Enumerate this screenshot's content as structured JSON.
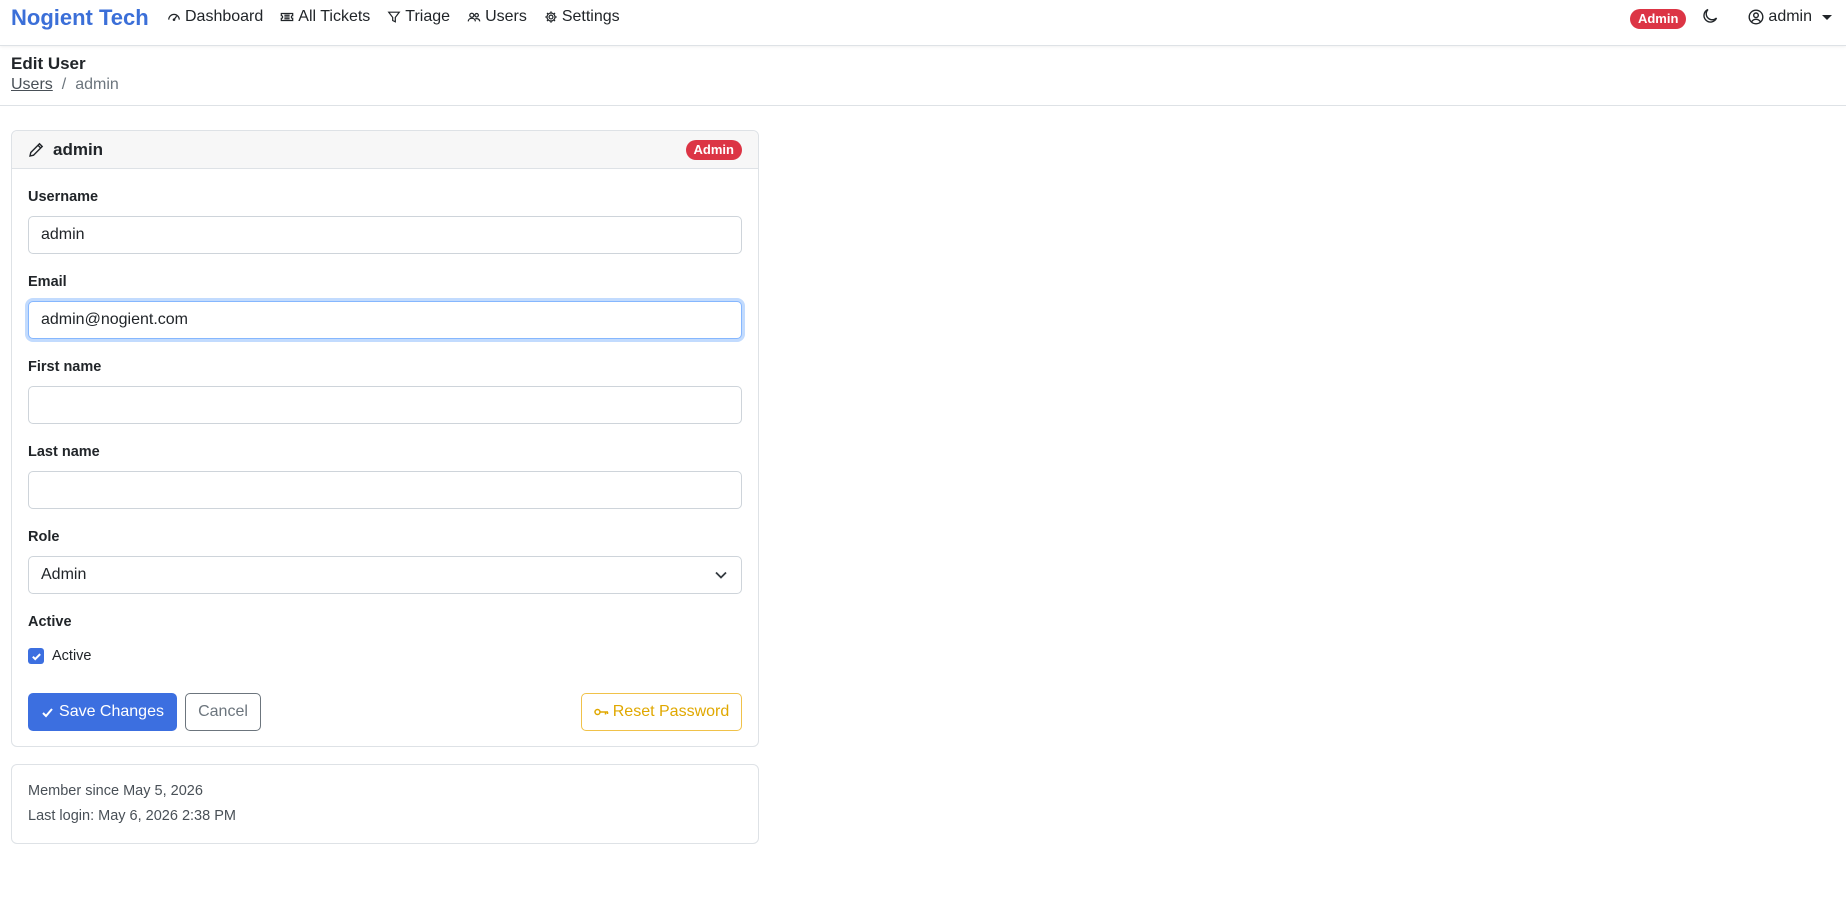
{
  "navbar": {
    "brand": "Nogient Tech",
    "links": [
      {
        "label": "Dashboard",
        "icon": "dashboard-icon"
      },
      {
        "label": "All Tickets",
        "icon": "ticket-icon"
      },
      {
        "label": "Triage",
        "icon": "filter-icon"
      },
      {
        "label": "Users",
        "icon": "users-icon"
      },
      {
        "label": "Settings",
        "icon": "gear-icon"
      }
    ],
    "role_badge": "Admin",
    "theme_icon": "moon-icon",
    "user_label": "admin"
  },
  "page": {
    "title": "Edit User",
    "breadcrumb": {
      "parent": "Users",
      "separator": "/",
      "current": "admin"
    }
  },
  "card": {
    "title": "admin",
    "badge": "Admin",
    "fields": {
      "username": {
        "label": "Username",
        "value": "admin"
      },
      "email": {
        "label": "Email",
        "value": "admin@nogient.com"
      },
      "first_name": {
        "label": "First name",
        "value": ""
      },
      "last_name": {
        "label": "Last name",
        "value": ""
      },
      "role": {
        "label": "Role",
        "value": "Admin"
      },
      "active": {
        "label": "Active",
        "checkbox_label": "Active",
        "checked": true
      }
    },
    "buttons": {
      "save": "Save Changes",
      "cancel": "Cancel",
      "reset": "Reset Password"
    }
  },
  "info": {
    "member_since": "Member since May 5, 2026",
    "last_login": "Last login: May 6, 2026 2:38 PM"
  },
  "colors": {
    "brand": "#3b6fd8",
    "primary": "#3c6fe0",
    "danger": "#dc3545",
    "warning": "#e0a800"
  }
}
